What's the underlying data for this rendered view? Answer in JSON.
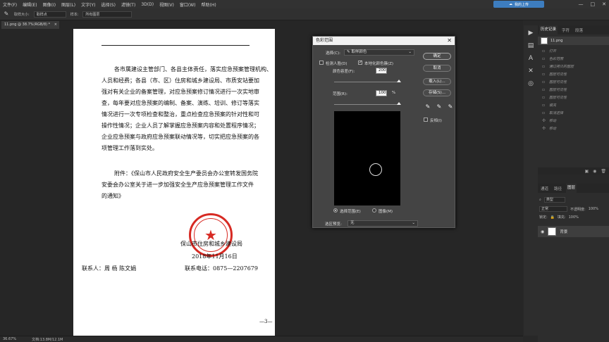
{
  "menu": [
    "文件(F)",
    "编辑(E)",
    "图像(I)",
    "图层(L)",
    "文字(Y)",
    "选择(S)",
    "滤镜(T)",
    "3D(D)",
    "视图(V)",
    "窗口(W)",
    "帮助(H)"
  ],
  "cloud_button": "我的上传",
  "window_controls": {
    "minimize": "—",
    "maximize": "□",
    "close": "✕"
  },
  "options_bar": {
    "sample_size_label": "取样大小:",
    "sample_size_value": "取样点",
    "sample_label": "样本:",
    "sample_value": "所有图层"
  },
  "document_tab": {
    "title": "11.png @ 38.7%(RGB/8) *",
    "close": "×"
  },
  "page_doc": {
    "para1": [
      "各市属建设主管部门、各县主体责任，落实应急预案管理机构、",
      "人员和经费；各县（市、区）住房和城乡建设局、市质安站要加",
      "强对有关企业的备案管理，对应急预案修订情况进行一次实地审",
      "查，每年要对应急预案的编制、备案、演练、培训、修订等落实",
      "情况进行一次专项检查和整治，重点检查应急预案的针对性和可",
      "操作性情况；企业人员了解掌握应急预案内容和处置程序情况；",
      "企业应急预案与政府应急预案联动情况等，切实把应急预案的各",
      "项管理工作落到实处。"
    ],
    "attachment": [
      "附件：《保山市人民政府安全生产委员会办公室转发国务院",
      "安委会办公室关于进一步加强安全生产应急预案管理工作文件",
      "的通知》"
    ],
    "org": "保山市住房和城乡建设局",
    "date": "2018年11月16日",
    "contact": "联系人：周  杨    陈文娟",
    "phone": "联系电话：0875—2207679",
    "page_number": "—3—"
  },
  "status_bar": {
    "zoom": "36.67%",
    "doc_size": "文档:13.8M/12.1M"
  },
  "color_range_dialog": {
    "title": "色彩范围",
    "close": "✕",
    "select_label": "选择(C):",
    "select_value": "取样颜色",
    "detect_faces": "检测人脸(D)",
    "localized": "本地化颜色簇(Z)",
    "fuzziness_label": "颜色容差(F):",
    "fuzziness_value": "200",
    "range_label": "范围(R):",
    "range_value": "100",
    "range_unit": "%",
    "ok": "确定",
    "cancel": "取消",
    "load": "载入(L)...",
    "save": "存储(S)...",
    "invert": "反相(I)",
    "selection_radio": "选择范围(E)",
    "image_radio": "图像(M)",
    "selection_preview_label": "选区预览:",
    "selection_preview_value": "无"
  },
  "history_panel": {
    "tabs": [
      "历史记录",
      "字符",
      "段落"
    ],
    "snapshot": "11.png",
    "items": [
      "打开",
      "色彩范围",
      "通过拷贝的图层",
      "图层可见性",
      "图层可见性",
      "图层可见性",
      "图层可见性",
      "填充",
      "取消选择",
      "移动",
      "移动"
    ]
  },
  "layers_panel": {
    "tabs": [
      "通道",
      "路径",
      "图层"
    ],
    "filter": "类型",
    "blend_mode": "正常",
    "opacity_label": "不透明度:",
    "opacity_value": "100%",
    "lock_label": "锁定:",
    "fill_label": "填充:",
    "fill_value": "100%",
    "background_layer": "背景"
  }
}
